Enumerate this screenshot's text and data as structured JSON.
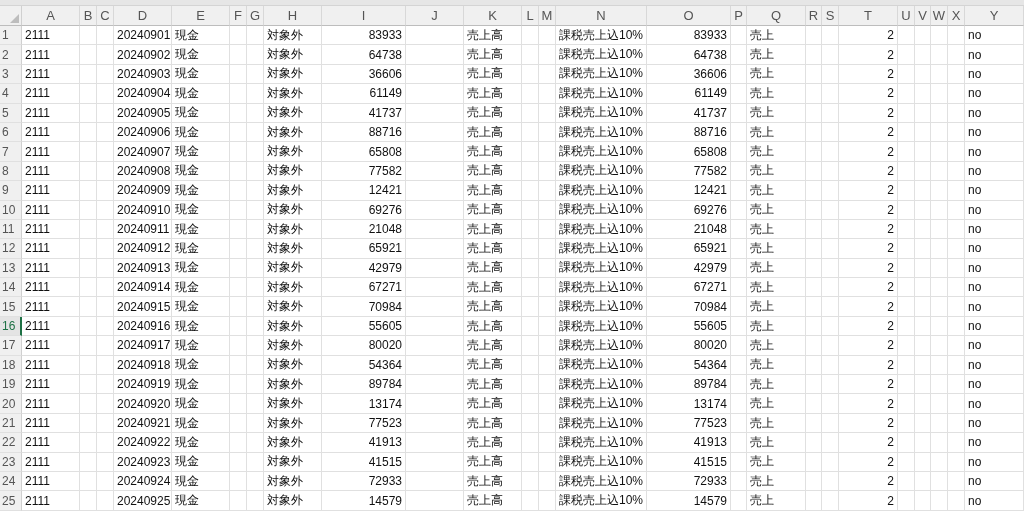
{
  "columns": [
    {
      "label": "A",
      "kind": "text"
    },
    {
      "label": "B",
      "kind": "text"
    },
    {
      "label": "C",
      "kind": "text"
    },
    {
      "label": "D",
      "kind": "text"
    },
    {
      "label": "E",
      "kind": "text"
    },
    {
      "label": "F",
      "kind": "text"
    },
    {
      "label": "G",
      "kind": "text"
    },
    {
      "label": "H",
      "kind": "text"
    },
    {
      "label": "I",
      "kind": "number"
    },
    {
      "label": "J",
      "kind": "text"
    },
    {
      "label": "K",
      "kind": "text"
    },
    {
      "label": "L",
      "kind": "text"
    },
    {
      "label": "M",
      "kind": "text"
    },
    {
      "label": "N",
      "kind": "text"
    },
    {
      "label": "O",
      "kind": "number"
    },
    {
      "label": "P",
      "kind": "text"
    },
    {
      "label": "Q",
      "kind": "text"
    },
    {
      "label": "R",
      "kind": "text"
    },
    {
      "label": "S",
      "kind": "text"
    },
    {
      "label": "T",
      "kind": "number"
    },
    {
      "label": "U",
      "kind": "text"
    },
    {
      "label": "V",
      "kind": "text"
    },
    {
      "label": "W",
      "kind": "text"
    },
    {
      "label": "X",
      "kind": "text"
    },
    {
      "label": "Y",
      "kind": "text"
    }
  ],
  "rows": [
    {
      "header": "1",
      "selected": false,
      "cells": {
        "A": "2111",
        "D": "20240901",
        "E": "現金",
        "H": "対象外",
        "I": "83933",
        "K": "売上高",
        "N": "課税売上込10%",
        "O": "83933",
        "Q": "売上",
        "T": "2",
        "Y": "no"
      }
    },
    {
      "header": "2",
      "selected": false,
      "cells": {
        "A": "2111",
        "D": "20240902",
        "E": "現金",
        "H": "対象外",
        "I": "64738",
        "K": "売上高",
        "N": "課税売上込10%",
        "O": "64738",
        "Q": "売上",
        "T": "2",
        "Y": "no"
      }
    },
    {
      "header": "3",
      "selected": false,
      "cells": {
        "A": "2111",
        "D": "20240903",
        "E": "現金",
        "H": "対象外",
        "I": "36606",
        "K": "売上高",
        "N": "課税売上込10%",
        "O": "36606",
        "Q": "売上",
        "T": "2",
        "Y": "no"
      }
    },
    {
      "header": "4",
      "selected": false,
      "cells": {
        "A": "2111",
        "D": "20240904",
        "E": "現金",
        "H": "対象外",
        "I": "61149",
        "K": "売上高",
        "N": "課税売上込10%",
        "O": "61149",
        "Q": "売上",
        "T": "2",
        "Y": "no"
      }
    },
    {
      "header": "5",
      "selected": false,
      "cells": {
        "A": "2111",
        "D": "20240905",
        "E": "現金",
        "H": "対象外",
        "I": "41737",
        "K": "売上高",
        "N": "課税売上込10%",
        "O": "41737",
        "Q": "売上",
        "T": "2",
        "Y": "no"
      }
    },
    {
      "header": "6",
      "selected": false,
      "cells": {
        "A": "2111",
        "D": "20240906",
        "E": "現金",
        "H": "対象外",
        "I": "88716",
        "K": "売上高",
        "N": "課税売上込10%",
        "O": "88716",
        "Q": "売上",
        "T": "2",
        "Y": "no"
      }
    },
    {
      "header": "7",
      "selected": false,
      "cells": {
        "A": "2111",
        "D": "20240907",
        "E": "現金",
        "H": "対象外",
        "I": "65808",
        "K": "売上高",
        "N": "課税売上込10%",
        "O": "65808",
        "Q": "売上",
        "T": "2",
        "Y": "no"
      }
    },
    {
      "header": "8",
      "selected": false,
      "cells": {
        "A": "2111",
        "D": "20240908",
        "E": "現金",
        "H": "対象外",
        "I": "77582",
        "K": "売上高",
        "N": "課税売上込10%",
        "O": "77582",
        "Q": "売上",
        "T": "2",
        "Y": "no"
      }
    },
    {
      "header": "9",
      "selected": false,
      "cells": {
        "A": "2111",
        "D": "20240909",
        "E": "現金",
        "H": "対象外",
        "I": "12421",
        "K": "売上高",
        "N": "課税売上込10%",
        "O": "12421",
        "Q": "売上",
        "T": "2",
        "Y": "no"
      }
    },
    {
      "header": "10",
      "selected": false,
      "cells": {
        "A": "2111",
        "D": "20240910",
        "E": "現金",
        "H": "対象外",
        "I": "69276",
        "K": "売上高",
        "N": "課税売上込10%",
        "O": "69276",
        "Q": "売上",
        "T": "2",
        "Y": "no"
      }
    },
    {
      "header": "11",
      "selected": false,
      "cells": {
        "A": "2111",
        "D": "20240911",
        "E": "現金",
        "H": "対象外",
        "I": "21048",
        "K": "売上高",
        "N": "課税売上込10%",
        "O": "21048",
        "Q": "売上",
        "T": "2",
        "Y": "no"
      }
    },
    {
      "header": "12",
      "selected": false,
      "cells": {
        "A": "2111",
        "D": "20240912",
        "E": "現金",
        "H": "対象外",
        "I": "65921",
        "K": "売上高",
        "N": "課税売上込10%",
        "O": "65921",
        "Q": "売上",
        "T": "2",
        "Y": "no"
      }
    },
    {
      "header": "13",
      "selected": false,
      "cells": {
        "A": "2111",
        "D": "20240913",
        "E": "現金",
        "H": "対象外",
        "I": "42979",
        "K": "売上高",
        "N": "課税売上込10%",
        "O": "42979",
        "Q": "売上",
        "T": "2",
        "Y": "no"
      }
    },
    {
      "header": "14",
      "selected": false,
      "cells": {
        "A": "2111",
        "D": "20240914",
        "E": "現金",
        "H": "対象外",
        "I": "67271",
        "K": "売上高",
        "N": "課税売上込10%",
        "O": "67271",
        "Q": "売上",
        "T": "2",
        "Y": "no"
      }
    },
    {
      "header": "15",
      "selected": false,
      "cells": {
        "A": "2111",
        "D": "20240915",
        "E": "現金",
        "H": "対象外",
        "I": "70984",
        "K": "売上高",
        "N": "課税売上込10%",
        "O": "70984",
        "Q": "売上",
        "T": "2",
        "Y": "no"
      }
    },
    {
      "header": "16",
      "selected": true,
      "cells": {
        "A": "2111",
        "D": "20240916",
        "E": "現金",
        "H": "対象外",
        "I": "55605",
        "K": "売上高",
        "N": "課税売上込10%",
        "O": "55605",
        "Q": "売上",
        "T": "2",
        "Y": "no"
      }
    },
    {
      "header": "17",
      "selected": false,
      "cells": {
        "A": "2111",
        "D": "20240917",
        "E": "現金",
        "H": "対象外",
        "I": "80020",
        "K": "売上高",
        "N": "課税売上込10%",
        "O": "80020",
        "Q": "売上",
        "T": "2",
        "Y": "no"
      }
    },
    {
      "header": "18",
      "selected": false,
      "cells": {
        "A": "2111",
        "D": "20240918",
        "E": "現金",
        "H": "対象外",
        "I": "54364",
        "K": "売上高",
        "N": "課税売上込10%",
        "O": "54364",
        "Q": "売上",
        "T": "2",
        "Y": "no"
      }
    },
    {
      "header": "19",
      "selected": false,
      "cells": {
        "A": "2111",
        "D": "20240919",
        "E": "現金",
        "H": "対象外",
        "I": "89784",
        "K": "売上高",
        "N": "課税売上込10%",
        "O": "89784",
        "Q": "売上",
        "T": "2",
        "Y": "no"
      }
    },
    {
      "header": "20",
      "selected": false,
      "cells": {
        "A": "2111",
        "D": "20240920",
        "E": "現金",
        "H": "対象外",
        "I": "13174",
        "K": "売上高",
        "N": "課税売上込10%",
        "O": "13174",
        "Q": "売上",
        "T": "2",
        "Y": "no"
      }
    },
    {
      "header": "21",
      "selected": false,
      "cells": {
        "A": "2111",
        "D": "20240921",
        "E": "現金",
        "H": "対象外",
        "I": "77523",
        "K": "売上高",
        "N": "課税売上込10%",
        "O": "77523",
        "Q": "売上",
        "T": "2",
        "Y": "no"
      }
    },
    {
      "header": "22",
      "selected": false,
      "cells": {
        "A": "2111",
        "D": "20240922",
        "E": "現金",
        "H": "対象外",
        "I": "41913",
        "K": "売上高",
        "N": "課税売上込10%",
        "O": "41913",
        "Q": "売上",
        "T": "2",
        "Y": "no"
      }
    },
    {
      "header": "23",
      "selected": false,
      "cells": {
        "A": "2111",
        "D": "20240923",
        "E": "現金",
        "H": "対象外",
        "I": "41515",
        "K": "売上高",
        "N": "課税売上込10%",
        "O": "41515",
        "Q": "売上",
        "T": "2",
        "Y": "no"
      }
    },
    {
      "header": "24",
      "selected": false,
      "cells": {
        "A": "2111",
        "D": "20240924",
        "E": "現金",
        "H": "対象外",
        "I": "72933",
        "K": "売上高",
        "N": "課税売上込10%",
        "O": "72933",
        "Q": "売上",
        "T": "2",
        "Y": "no"
      }
    },
    {
      "header": "25",
      "selected": false,
      "cells": {
        "A": "2111",
        "D": "20240925",
        "E": "現金",
        "H": "対象外",
        "I": "14579",
        "K": "売上高",
        "N": "課税売上込10%",
        "O": "14579",
        "Q": "売上",
        "T": "2",
        "Y": "no"
      }
    }
  ]
}
